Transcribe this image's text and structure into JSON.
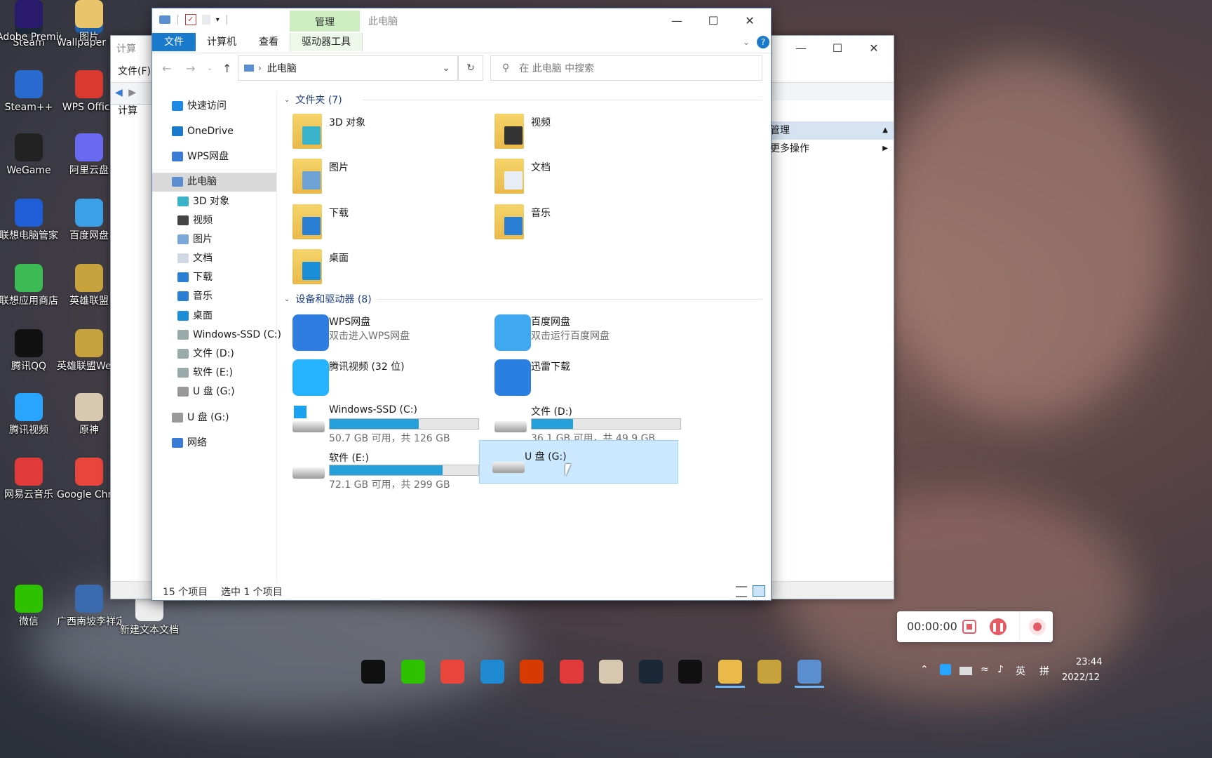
{
  "desktop": {
    "icons": [
      {
        "label": "Steam",
        "color": "#1b2838"
      },
      {
        "label": "Wallpaper Engine: ...",
        "color": "#1e5fa8"
      },
      {
        "label": "Steam++",
        "color": "#2a6bd1"
      },
      {
        "label": "WPS Office",
        "color": "#d93b30"
      },
      {
        "label": "WeGame",
        "color": "#222"
      },
      {
        "label": "阿里云盘",
        "color": "#6a6af0"
      },
      {
        "label": "联想电脑管家",
        "color": "#1e5fd8"
      },
      {
        "label": "百度网盘",
        "color": "#3aa0e8"
      },
      {
        "label": "联想应用商店",
        "color": "#3cba54"
      },
      {
        "label": "英雄联盟",
        "color": "#c8a23c"
      },
      {
        "label": "腾讯QQ",
        "color": "#111"
      },
      {
        "label": "英雄联盟WeGame版",
        "color": "#c8a23c"
      },
      {
        "label": "腾讯视频",
        "color": "#2aa5ff"
      },
      {
        "label": "原神",
        "color": "#d9c8b0"
      },
      {
        "label": "网易云音乐",
        "color": "#e03a3a"
      },
      {
        "label": "Google Chrome",
        "color": "#e8453c"
      },
      {
        "label": "微信",
        "color": "#2dc100"
      },
      {
        "label": "广西南坡李祥定岗答辩",
        "color": "#3a6ab0"
      },
      {
        "label": "Adobe Premie...",
        "color": "#2a1a6e"
      },
      {
        "label": "图片",
        "color": "#e9c46a"
      },
      {
        "label": "新建文本文档",
        "color": "#eee"
      }
    ]
  },
  "back_window": {
    "title": "计算",
    "menu_file": "文件(F)",
    "tree_root": "计算",
    "right_pane_header": "管理",
    "right_pane_item": "更多操作"
  },
  "explorer": {
    "title": "此电脑",
    "ribbon": {
      "manage_tab": "管理",
      "tabs": [
        "文件",
        "计算机",
        "查看",
        "驱动器工具"
      ]
    },
    "address": "此电脑",
    "search_placeholder": "在 此电脑 中搜索",
    "sidebar": [
      {
        "label": "快速访问",
        "icon": "star-icon",
        "indent": 0
      },
      {
        "label": "OneDrive",
        "icon": "cloud-icon",
        "indent": 0
      },
      {
        "label": "WPS网盘",
        "icon": "wps-cloud-icon",
        "indent": 0
      },
      {
        "label": "此电脑",
        "icon": "computer-icon",
        "indent": 0,
        "selected": true
      },
      {
        "label": "3D 对象",
        "icon": "cube-icon",
        "indent": 1
      },
      {
        "label": "视频",
        "icon": "video-icon",
        "indent": 1
      },
      {
        "label": "图片",
        "icon": "picture-icon",
        "indent": 1
      },
      {
        "label": "文档",
        "icon": "document-icon",
        "indent": 1
      },
      {
        "label": "下载",
        "icon": "download-icon",
        "indent": 1
      },
      {
        "label": "音乐",
        "icon": "music-icon",
        "indent": 1
      },
      {
        "label": "桌面",
        "icon": "desktop-icon",
        "indent": 1
      },
      {
        "label": "Windows-SSD (C:)",
        "icon": "drive-icon",
        "indent": 1
      },
      {
        "label": "文件 (D:)",
        "icon": "drive-icon",
        "indent": 1
      },
      {
        "label": "软件 (E:)",
        "icon": "drive-icon",
        "indent": 1
      },
      {
        "label": "U 盘 (G:)",
        "icon": "usb-drive-icon",
        "indent": 1
      },
      {
        "label": "U 盘 (G:)",
        "icon": "usb-drive-icon",
        "indent": 0
      },
      {
        "label": "网络",
        "icon": "network-icon",
        "indent": 0
      }
    ],
    "folders_header": "文件夹 (7)",
    "folders": [
      {
        "label": "3D 对象",
        "icon": "cube-icon"
      },
      {
        "label": "视频",
        "icon": "video-icon"
      },
      {
        "label": "图片",
        "icon": "picture-icon"
      },
      {
        "label": "文档",
        "icon": "document-icon"
      },
      {
        "label": "下载",
        "icon": "download-icon"
      },
      {
        "label": "音乐",
        "icon": "music-icon"
      },
      {
        "label": "桌面",
        "icon": "desktop-icon"
      }
    ],
    "devices_header": "设备和驱动器 (8)",
    "apps": [
      {
        "label": "WPS网盘",
        "sub": "双击进入WPS网盘",
        "icon": "wps-cloud-icon"
      },
      {
        "label": "百度网盘",
        "sub": "双击运行百度网盘",
        "icon": "baidu-netdisk-icon"
      },
      {
        "label": "腾讯视频 (32 位)",
        "sub": "",
        "icon": "tencent-video-icon"
      },
      {
        "label": "迅雷下载",
        "sub": "",
        "icon": "xunlei-icon"
      }
    ],
    "drives": [
      {
        "label": "Windows-SSD (C:)",
        "usage": "50.7 GB 可用，共 126 GB",
        "used_fraction": 0.6
      },
      {
        "label": "文件 (D:)",
        "usage": "36.1 GB 可用，共 49.9 GB",
        "used_fraction": 0.28
      },
      {
        "label": "软件 (E:)",
        "usage": "72.1 GB 可用，共 299 GB",
        "used_fraction": 0.76
      },
      {
        "label": "U 盘 (G:)",
        "usage": "",
        "selected": true
      }
    ],
    "status_count": "15 个项目",
    "status_selected": "选中 1 个项目"
  },
  "recorder": {
    "time": "00:00:00"
  },
  "taskbar": {
    "apps": [
      "QQ",
      "微信",
      "Chrome",
      "Edge",
      "Office",
      "网易云",
      "原神",
      "Steam",
      "GoLand",
      "资源管理器",
      "文件",
      "计算机管理"
    ],
    "tray_ime1": "英",
    "tray_ime2": "拼",
    "clock_time": "23:44",
    "clock_date": "2022/12"
  }
}
